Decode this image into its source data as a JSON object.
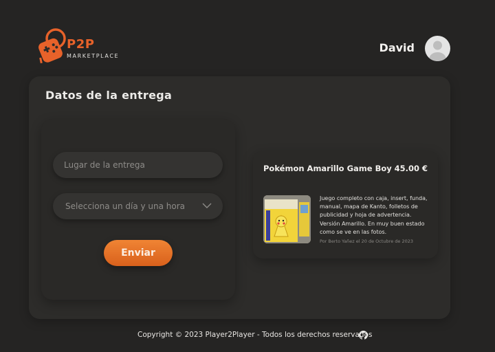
{
  "header": {
    "logo_text": "P2P",
    "logo_subtext": "MARKETPLACE",
    "user_name": "David"
  },
  "page": {
    "title": "Datos de la entrega"
  },
  "form": {
    "location_placeholder": "Lugar de la entrega",
    "datetime_placeholder": "Selecciona un día y una hora",
    "submit_label": "Enviar"
  },
  "product": {
    "title": "Pokémon Amarillo Game Boy",
    "price": "45.00 €",
    "description": "Juego completo con caja, insert, funda, manual, mapa de Kanto, folletos de publicidad y hoja de advertencia. Versión Amarillo. En muy buen estado como se ve en las fotos.",
    "meta": "Por Berto Yañez el 20 de Octubre de 2023"
  },
  "footer": {
    "copyright": "Copyright © 2023 Player2Player - Todos los derechos reservados"
  },
  "colors": {
    "background": "#252423",
    "accent": "#e7622a",
    "card": "#2d2c2a"
  },
  "icons": {
    "logo": "gamepad-icon",
    "avatar": "user-avatar-icon",
    "chevron": "chevron-down-icon",
    "github": "github-icon"
  }
}
